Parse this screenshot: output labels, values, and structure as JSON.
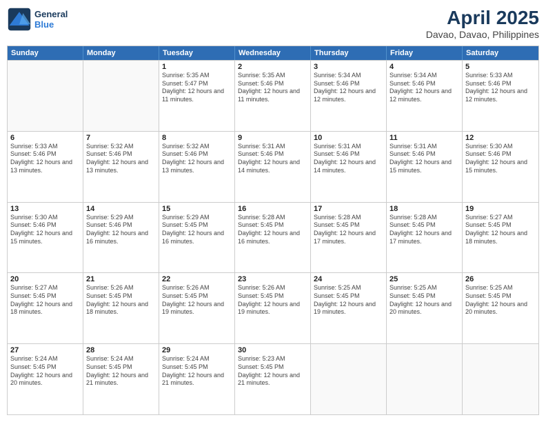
{
  "logo": {
    "line1": "General",
    "line2": "Blue"
  },
  "title": {
    "month": "April 2025",
    "location": "Davao, Davao, Philippines"
  },
  "header_days": [
    "Sunday",
    "Monday",
    "Tuesday",
    "Wednesday",
    "Thursday",
    "Friday",
    "Saturday"
  ],
  "weeks": [
    [
      {
        "day": "",
        "sunrise": "",
        "sunset": "",
        "daylight": ""
      },
      {
        "day": "",
        "sunrise": "",
        "sunset": "",
        "daylight": ""
      },
      {
        "day": "1",
        "sunrise": "Sunrise: 5:35 AM",
        "sunset": "Sunset: 5:47 PM",
        "daylight": "Daylight: 12 hours and 11 minutes."
      },
      {
        "day": "2",
        "sunrise": "Sunrise: 5:35 AM",
        "sunset": "Sunset: 5:46 PM",
        "daylight": "Daylight: 12 hours and 11 minutes."
      },
      {
        "day": "3",
        "sunrise": "Sunrise: 5:34 AM",
        "sunset": "Sunset: 5:46 PM",
        "daylight": "Daylight: 12 hours and 12 minutes."
      },
      {
        "day": "4",
        "sunrise": "Sunrise: 5:34 AM",
        "sunset": "Sunset: 5:46 PM",
        "daylight": "Daylight: 12 hours and 12 minutes."
      },
      {
        "day": "5",
        "sunrise": "Sunrise: 5:33 AM",
        "sunset": "Sunset: 5:46 PM",
        "daylight": "Daylight: 12 hours and 12 minutes."
      }
    ],
    [
      {
        "day": "6",
        "sunrise": "Sunrise: 5:33 AM",
        "sunset": "Sunset: 5:46 PM",
        "daylight": "Daylight: 12 hours and 13 minutes."
      },
      {
        "day": "7",
        "sunrise": "Sunrise: 5:32 AM",
        "sunset": "Sunset: 5:46 PM",
        "daylight": "Daylight: 12 hours and 13 minutes."
      },
      {
        "day": "8",
        "sunrise": "Sunrise: 5:32 AM",
        "sunset": "Sunset: 5:46 PM",
        "daylight": "Daylight: 12 hours and 13 minutes."
      },
      {
        "day": "9",
        "sunrise": "Sunrise: 5:31 AM",
        "sunset": "Sunset: 5:46 PM",
        "daylight": "Daylight: 12 hours and 14 minutes."
      },
      {
        "day": "10",
        "sunrise": "Sunrise: 5:31 AM",
        "sunset": "Sunset: 5:46 PM",
        "daylight": "Daylight: 12 hours and 14 minutes."
      },
      {
        "day": "11",
        "sunrise": "Sunrise: 5:31 AM",
        "sunset": "Sunset: 5:46 PM",
        "daylight": "Daylight: 12 hours and 15 minutes."
      },
      {
        "day": "12",
        "sunrise": "Sunrise: 5:30 AM",
        "sunset": "Sunset: 5:46 PM",
        "daylight": "Daylight: 12 hours and 15 minutes."
      }
    ],
    [
      {
        "day": "13",
        "sunrise": "Sunrise: 5:30 AM",
        "sunset": "Sunset: 5:46 PM",
        "daylight": "Daylight: 12 hours and 15 minutes."
      },
      {
        "day": "14",
        "sunrise": "Sunrise: 5:29 AM",
        "sunset": "Sunset: 5:46 PM",
        "daylight": "Daylight: 12 hours and 16 minutes."
      },
      {
        "day": "15",
        "sunrise": "Sunrise: 5:29 AM",
        "sunset": "Sunset: 5:45 PM",
        "daylight": "Daylight: 12 hours and 16 minutes."
      },
      {
        "day": "16",
        "sunrise": "Sunrise: 5:28 AM",
        "sunset": "Sunset: 5:45 PM",
        "daylight": "Daylight: 12 hours and 16 minutes."
      },
      {
        "day": "17",
        "sunrise": "Sunrise: 5:28 AM",
        "sunset": "Sunset: 5:45 PM",
        "daylight": "Daylight: 12 hours and 17 minutes."
      },
      {
        "day": "18",
        "sunrise": "Sunrise: 5:28 AM",
        "sunset": "Sunset: 5:45 PM",
        "daylight": "Daylight: 12 hours and 17 minutes."
      },
      {
        "day": "19",
        "sunrise": "Sunrise: 5:27 AM",
        "sunset": "Sunset: 5:45 PM",
        "daylight": "Daylight: 12 hours and 18 minutes."
      }
    ],
    [
      {
        "day": "20",
        "sunrise": "Sunrise: 5:27 AM",
        "sunset": "Sunset: 5:45 PM",
        "daylight": "Daylight: 12 hours and 18 minutes."
      },
      {
        "day": "21",
        "sunrise": "Sunrise: 5:26 AM",
        "sunset": "Sunset: 5:45 PM",
        "daylight": "Daylight: 12 hours and 18 minutes."
      },
      {
        "day": "22",
        "sunrise": "Sunrise: 5:26 AM",
        "sunset": "Sunset: 5:45 PM",
        "daylight": "Daylight: 12 hours and 19 minutes."
      },
      {
        "day": "23",
        "sunrise": "Sunrise: 5:26 AM",
        "sunset": "Sunset: 5:45 PM",
        "daylight": "Daylight: 12 hours and 19 minutes."
      },
      {
        "day": "24",
        "sunrise": "Sunrise: 5:25 AM",
        "sunset": "Sunset: 5:45 PM",
        "daylight": "Daylight: 12 hours and 19 minutes."
      },
      {
        "day": "25",
        "sunrise": "Sunrise: 5:25 AM",
        "sunset": "Sunset: 5:45 PM",
        "daylight": "Daylight: 12 hours and 20 minutes."
      },
      {
        "day": "26",
        "sunrise": "Sunrise: 5:25 AM",
        "sunset": "Sunset: 5:45 PM",
        "daylight": "Daylight: 12 hours and 20 minutes."
      }
    ],
    [
      {
        "day": "27",
        "sunrise": "Sunrise: 5:24 AM",
        "sunset": "Sunset: 5:45 PM",
        "daylight": "Daylight: 12 hours and 20 minutes."
      },
      {
        "day": "28",
        "sunrise": "Sunrise: 5:24 AM",
        "sunset": "Sunset: 5:45 PM",
        "daylight": "Daylight: 12 hours and 21 minutes."
      },
      {
        "day": "29",
        "sunrise": "Sunrise: 5:24 AM",
        "sunset": "Sunset: 5:45 PM",
        "daylight": "Daylight: 12 hours and 21 minutes."
      },
      {
        "day": "30",
        "sunrise": "Sunrise: 5:23 AM",
        "sunset": "Sunset: 5:45 PM",
        "daylight": "Daylight: 12 hours and 21 minutes."
      },
      {
        "day": "",
        "sunrise": "",
        "sunset": "",
        "daylight": ""
      },
      {
        "day": "",
        "sunrise": "",
        "sunset": "",
        "daylight": ""
      },
      {
        "day": "",
        "sunrise": "",
        "sunset": "",
        "daylight": ""
      }
    ]
  ]
}
